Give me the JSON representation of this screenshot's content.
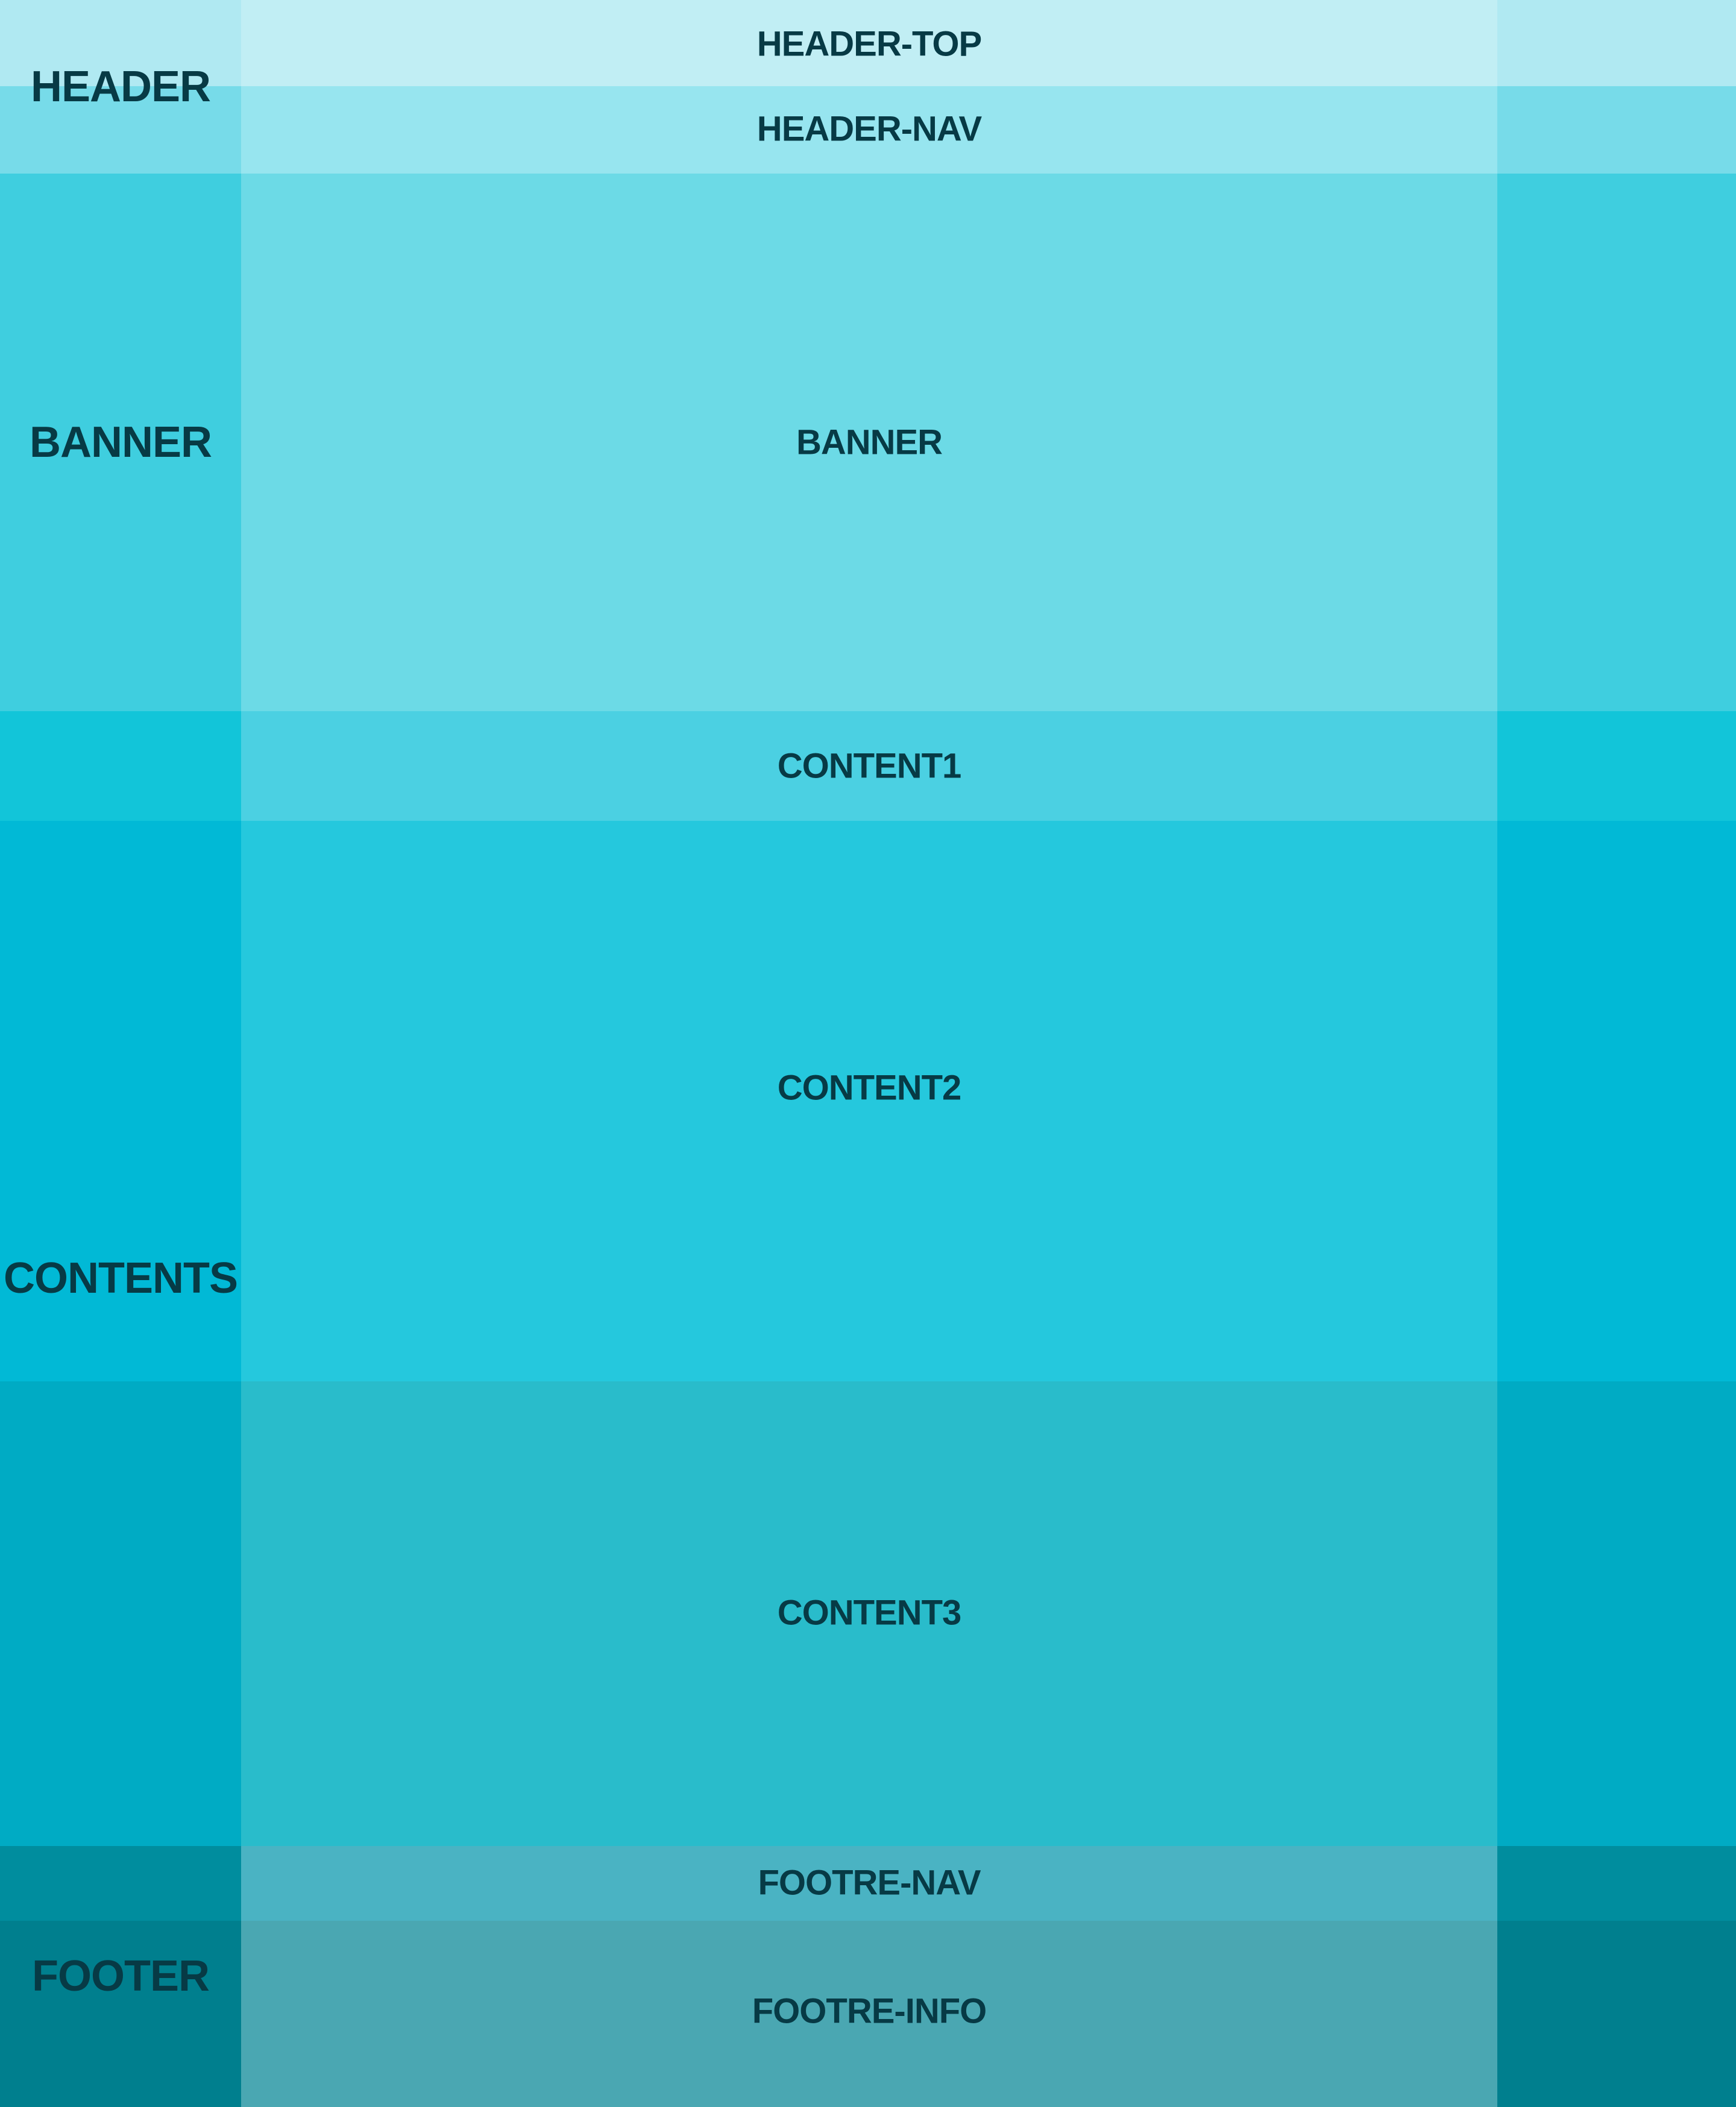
{
  "bands": [
    {
      "label": "HEADER-TOP",
      "outer": "#b0e9f2",
      "inner": "#c1eef4"
    },
    {
      "label": "HEADER-NAV",
      "outer": "#77dbe9",
      "inner": "#97e5ef"
    },
    {
      "label": "BANNER",
      "outer": "#3fcedf",
      "inner": "#6cdae6"
    },
    {
      "label": "CONTENT1",
      "outer": "#12c5d9",
      "inner": "#4bd0e2"
    },
    {
      "label": "CONTENT2",
      "outer": "#01b9d6",
      "inner": "#25c8dd"
    },
    {
      "label": "CONTENT3",
      "outer": "#00abc4",
      "inner": "#29bccb"
    },
    {
      "label": "FOOTRE-NAV",
      "outer": "#008d9e",
      "inner": "#4ab3c3"
    },
    {
      "label": "FOOTRE-INFO",
      "outer": "#007f8e",
      "inner": "#4aa7b2"
    }
  ],
  "groups": {
    "header": "HEADER",
    "banner": "BANNER",
    "contents": "CONTENTS",
    "footer": "FOOTER"
  }
}
